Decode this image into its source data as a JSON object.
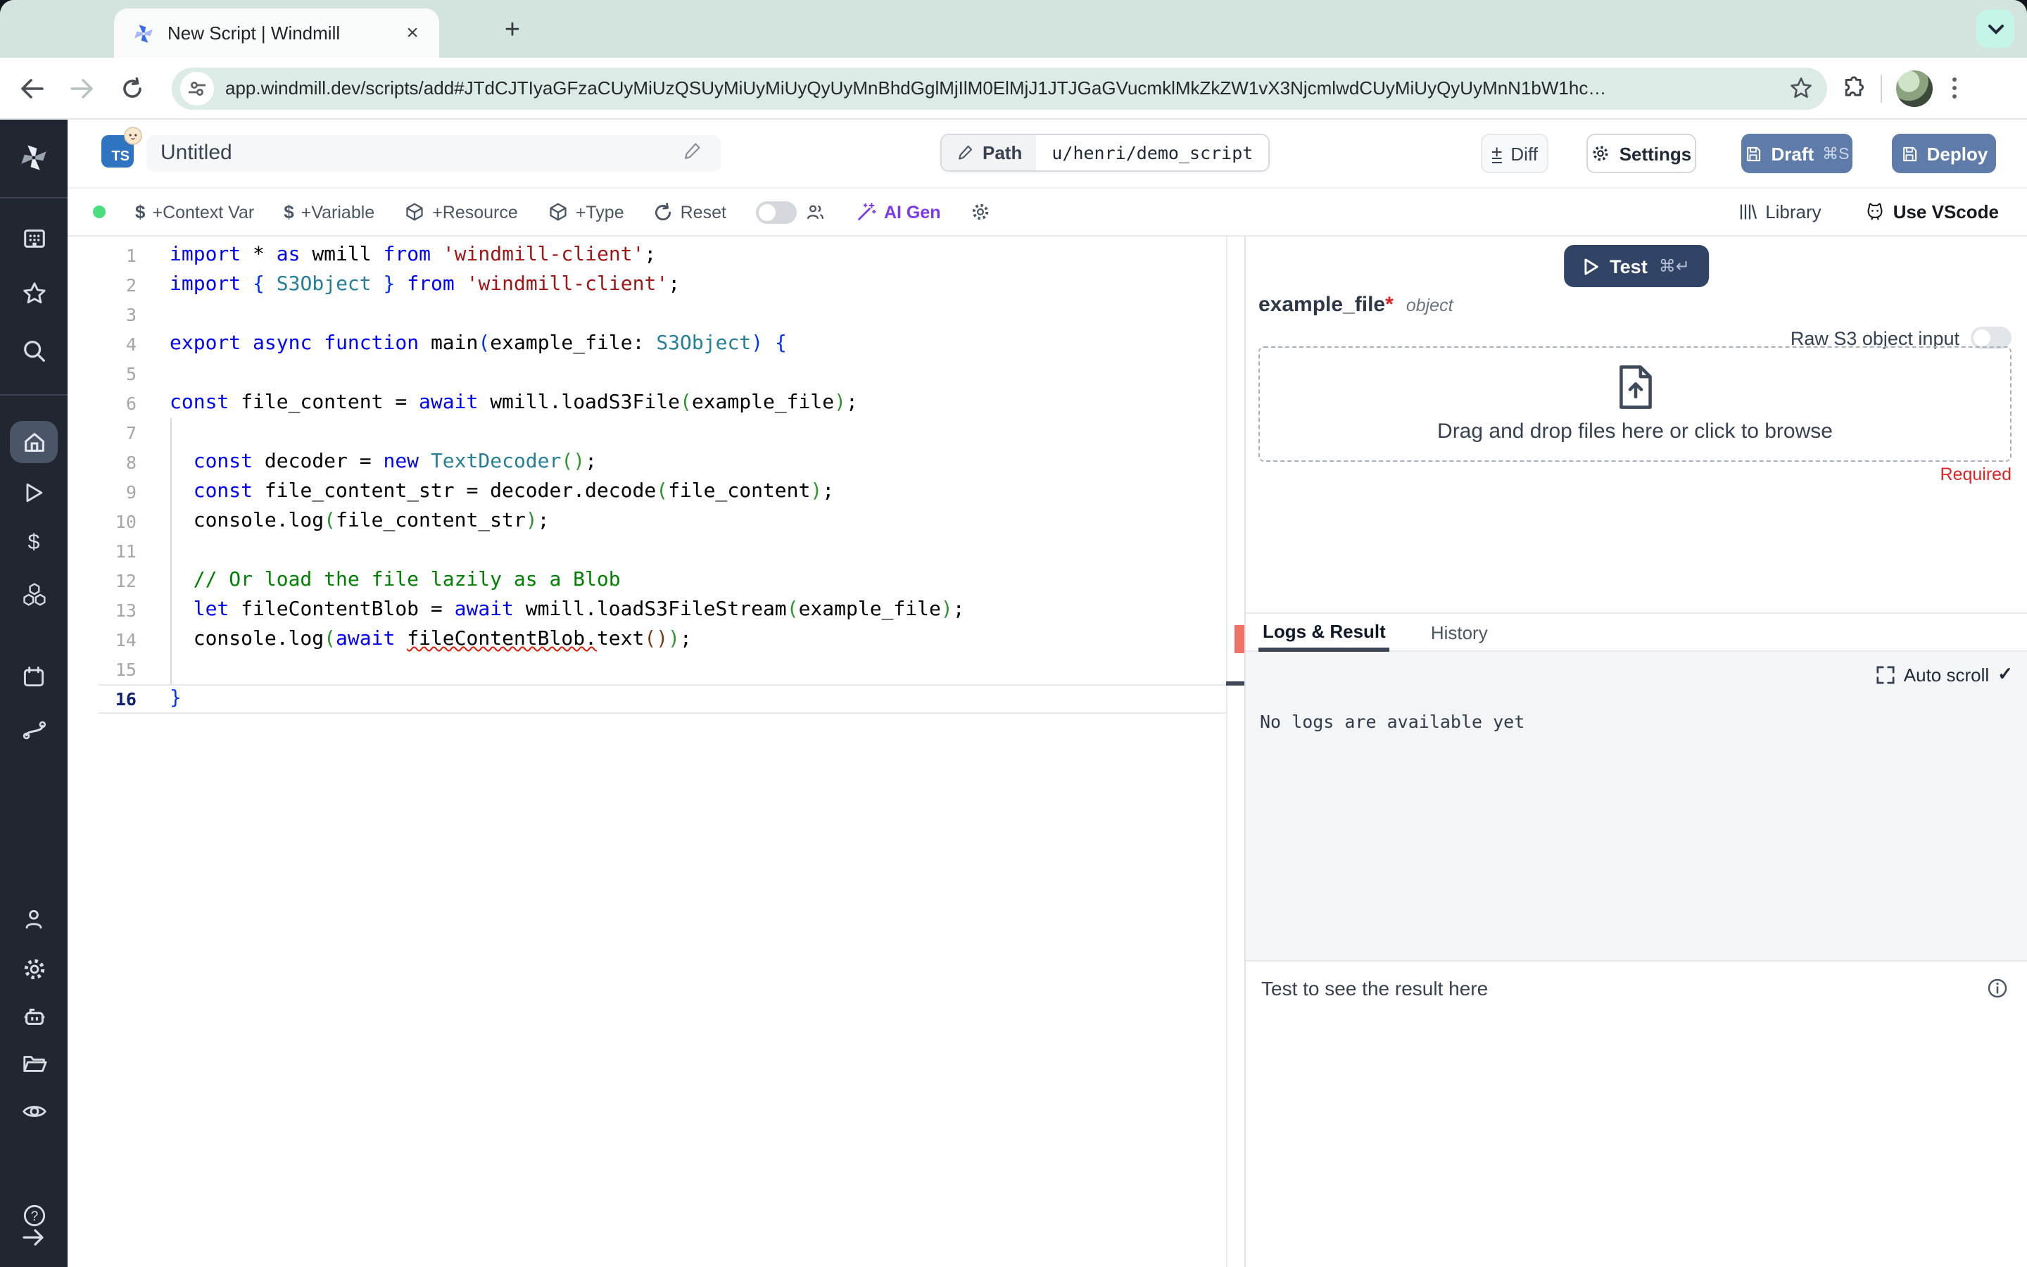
{
  "browser": {
    "tab_title": "New Script | Windmill",
    "close_label": "×",
    "new_tab_label": "+",
    "url": "app.windmill.dev/scripts/add#JTdCJTIyaGFzaCUyMiUzQSUyMiUyMiUyQyUyMnBhdGglMjIlM0ElMjJ1JTJGaGVucmklMkZkZW1vX3NjcmlwdCUyMiUyQyUyMnN1bW1hc…"
  },
  "sidebar": {
    "items": [
      "windmill-logo",
      "workspace",
      "favorites",
      "search",
      "home",
      "runs",
      "variables",
      "resources",
      "schedules",
      "routes",
      "account",
      "settings",
      "workers",
      "folders",
      "audit-logs",
      "help",
      "collapse"
    ]
  },
  "header": {
    "lang_badge": "TS",
    "title": "Untitled",
    "path_label": "Path",
    "path_value": "u/henri/demo_script",
    "diff_label": "Diff",
    "diff_icon": "±",
    "settings_label": "Settings",
    "draft_label": "Draft",
    "draft_shortcut": "⌘S",
    "deploy_label": "Deploy"
  },
  "toolbar": {
    "dollar": "$",
    "context_var": "+Context Var",
    "variable": "+Variable",
    "resource": "+Resource",
    "type": "+Type",
    "reset": "Reset",
    "ai_gen": "AI Gen",
    "library": "Library",
    "vscode": "Use VScode"
  },
  "editor": {
    "active_line": 16,
    "lines": [
      {
        "n": 1,
        "tokens": [
          [
            "import",
            "kw"
          ],
          [
            " * ",
            "pl"
          ],
          [
            "as",
            "kw"
          ],
          [
            " wmill ",
            "pl"
          ],
          [
            "from",
            "kw"
          ],
          [
            " ",
            "pl"
          ],
          [
            "'windmill-client'",
            "str"
          ],
          [
            ";",
            "pl"
          ]
        ]
      },
      {
        "n": 2,
        "tokens": [
          [
            "import",
            "kw"
          ],
          [
            " ",
            "pl"
          ],
          [
            "{",
            "b1"
          ],
          [
            " ",
            "pl"
          ],
          [
            "S3Object",
            "ty"
          ],
          [
            " ",
            "pl"
          ],
          [
            "}",
            "b1"
          ],
          [
            " ",
            "pl"
          ],
          [
            "from",
            "kw"
          ],
          [
            " ",
            "pl"
          ],
          [
            "'windmill-client'",
            "str"
          ],
          [
            ";",
            "pl"
          ]
        ]
      },
      {
        "n": 3,
        "tokens": []
      },
      {
        "n": 4,
        "tokens": [
          [
            "export",
            "kw"
          ],
          [
            " ",
            "pl"
          ],
          [
            "async",
            "kw"
          ],
          [
            " ",
            "pl"
          ],
          [
            "function",
            "kw"
          ],
          [
            " main",
            "pl"
          ],
          [
            "(",
            "b1"
          ],
          [
            "example_file: ",
            "pl"
          ],
          [
            "S3Object",
            "ty"
          ],
          [
            ")",
            "b1"
          ],
          [
            " ",
            "pl"
          ],
          [
            "{",
            "b1"
          ]
        ]
      },
      {
        "n": 5,
        "tokens": []
      },
      {
        "n": 6,
        "tokens": [
          [
            "const",
            "kw"
          ],
          [
            " file_content = ",
            "pl"
          ],
          [
            "await",
            "kw"
          ],
          [
            " wmill.loadS3File",
            "pl"
          ],
          [
            "(",
            "b2"
          ],
          [
            "example_file",
            "pl"
          ],
          [
            ")",
            "b2"
          ],
          [
            ";",
            "pl"
          ]
        ]
      },
      {
        "n": 7,
        "tokens": []
      },
      {
        "n": 8,
        "tokens": [
          [
            "  ",
            "pl"
          ],
          [
            "const",
            "kw"
          ],
          [
            " decoder = ",
            "pl"
          ],
          [
            "new",
            "kw"
          ],
          [
            " ",
            "pl"
          ],
          [
            "TextDecoder",
            "ty"
          ],
          [
            "(",
            "b2"
          ],
          [
            ")",
            "b2"
          ],
          [
            ";",
            "pl"
          ]
        ]
      },
      {
        "n": 9,
        "tokens": [
          [
            "  ",
            "pl"
          ],
          [
            "const",
            "kw"
          ],
          [
            " file_content_str = decoder.decode",
            "pl"
          ],
          [
            "(",
            "b2"
          ],
          [
            "file_content",
            "pl"
          ],
          [
            ")",
            "b2"
          ],
          [
            ";",
            "pl"
          ]
        ]
      },
      {
        "n": 10,
        "tokens": [
          [
            "  console.log",
            "pl"
          ],
          [
            "(",
            "b2"
          ],
          [
            "file_content_str",
            "pl"
          ],
          [
            ")",
            "b2"
          ],
          [
            ";",
            "pl"
          ]
        ]
      },
      {
        "n": 11,
        "tokens": []
      },
      {
        "n": 12,
        "tokens": [
          [
            "  ",
            "pl"
          ],
          [
            "// Or load the file lazily as a Blob",
            "com"
          ]
        ]
      },
      {
        "n": 13,
        "tokens": [
          [
            "  ",
            "pl"
          ],
          [
            "let",
            "kw"
          ],
          [
            " fileContentBlob = ",
            "pl"
          ],
          [
            "await",
            "kw"
          ],
          [
            " wmill.loadS3FileStream",
            "pl"
          ],
          [
            "(",
            "b2"
          ],
          [
            "example_file",
            "pl"
          ],
          [
            ")",
            "b2"
          ],
          [
            ";",
            "pl"
          ]
        ]
      },
      {
        "n": 14,
        "tokens": [
          [
            "  console.log",
            "pl"
          ],
          [
            "(",
            "b2"
          ],
          [
            "await",
            "kw"
          ],
          [
            " ",
            "pl"
          ],
          [
            "fileContentBlob.",
            "err"
          ],
          [
            "text",
            "pl"
          ],
          [
            "(",
            "b3"
          ],
          [
            ")",
            "b3"
          ],
          [
            ")",
            "b2"
          ],
          [
            ";",
            "pl"
          ]
        ]
      },
      {
        "n": 15,
        "tokens": []
      },
      {
        "n": 16,
        "tokens": [
          [
            "}",
            "b1"
          ]
        ]
      }
    ]
  },
  "panel": {
    "test_label": "Test",
    "test_shortcut": "⌘↵",
    "arg_name": "example_file",
    "arg_required_mark": "*",
    "arg_type": "object",
    "raw_s3_label": "Raw S3 object input",
    "dropzone_text": "Drag and drop files here or click to browse",
    "required_label": "Required",
    "tabs": [
      "Logs & Result",
      "History"
    ],
    "auto_scroll_label": "Auto scroll",
    "auto_scroll_check": "✓",
    "no_logs_text": "No logs are available yet",
    "result_placeholder": "Test to see the result here"
  },
  "colors": {
    "ts_badge_blue": "#2f74c0",
    "primary_button_slate": "#5e7ba9",
    "test_button_navy": "#324466",
    "ai_gen_violet": "#7c3aed",
    "error_red": "#dc2626",
    "overview_error_marker": "#ee7268",
    "sidebar_bg": "#212631",
    "sidebar_active_bg": "#4a5568",
    "tabstrip_bg": "#d3e4de",
    "status_dot_green": "#4ade80"
  }
}
